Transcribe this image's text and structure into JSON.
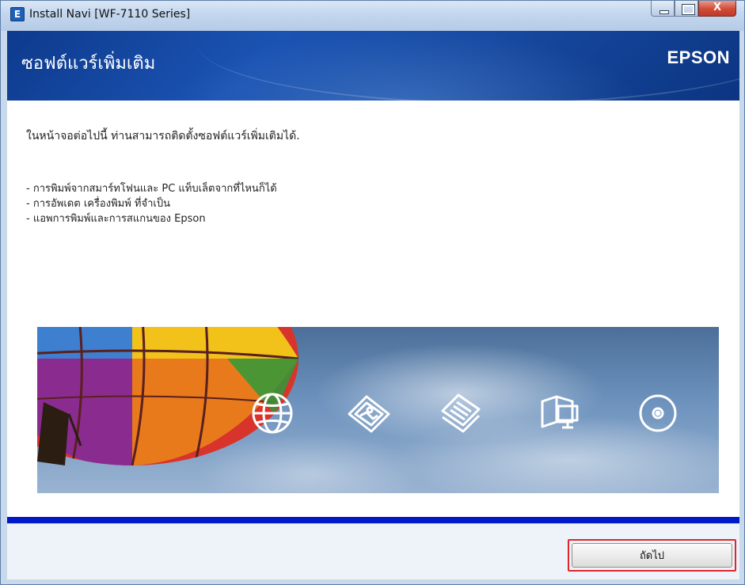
{
  "window": {
    "title": "Install Navi [WF-7110 Series]",
    "icon_letter": "E"
  },
  "header": {
    "title": "ซอฟต์แวร์เพิ่มเติม",
    "brand": "EPSON"
  },
  "main": {
    "intro": "ในหน้าจอต่อไปนี้ ท่านสามารถติดตั้งซอฟต์แวร์เพิ่มเติมได้.",
    "bullets": [
      "- การพิมพ์จากสมาร์ทโฟนและ PC แท็บเล็ตจากที่ไหนก็ได้",
      "- การอัพเดต เครื่องพิมพ์ ที่จำเป็น",
      "- แอพการพิมพ์และการสแกนของ Epson"
    ],
    "banner_icons": [
      "globe-icon",
      "photo-icon",
      "documents-icon",
      "manual-icon",
      "disc-icon"
    ]
  },
  "footer": {
    "next_label": "ถัดไป"
  },
  "colors": {
    "header_blue": "#174aa2",
    "divider_blue": "#0018c8",
    "highlight_red": "#e0262b"
  }
}
